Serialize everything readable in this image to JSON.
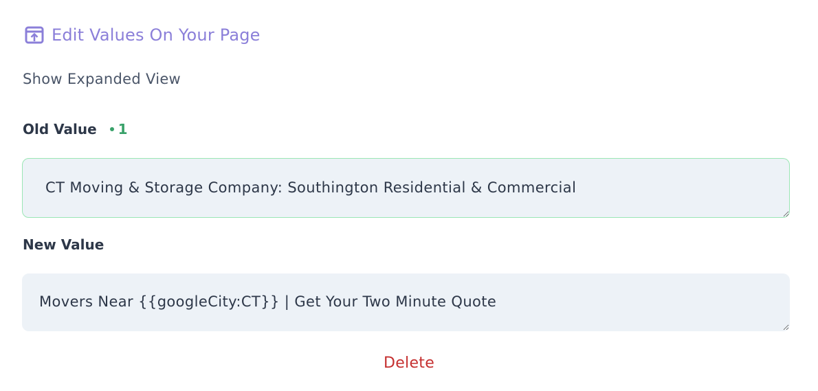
{
  "header": {
    "edit_link_label": "Edit Values On Your Page",
    "edit_link_icon": "open-in-new-window-icon",
    "accent_color": "#8b7fd9"
  },
  "view_toggle": {
    "label": "Show Expanded View"
  },
  "old_value": {
    "label": "Old Value",
    "count": "1",
    "count_color": "#38a169",
    "value": "CT Moving & Storage Company: Southington Residential & Commercial"
  },
  "new_value": {
    "label": "New Value",
    "value": "Movers Near {{googleCity:CT}} | Get Your Two Minute Quote"
  },
  "actions": {
    "delete_label": "Delete",
    "delete_color": "#c53030"
  }
}
